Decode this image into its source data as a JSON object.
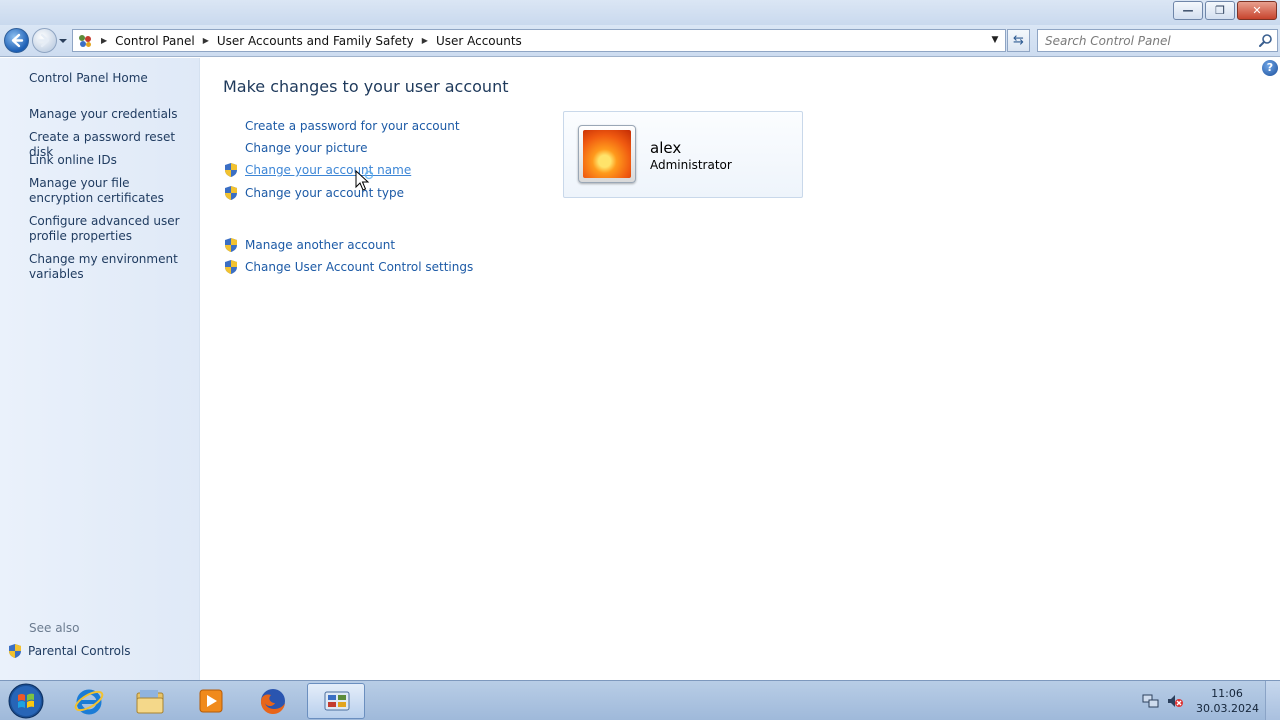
{
  "window": {
    "minimize_glyph": "—",
    "restore_glyph": "❐",
    "close_glyph": "✕"
  },
  "address_bar": {
    "breadcrumbs": [
      "Control Panel",
      "User Accounts and Family Safety",
      "User Accounts"
    ]
  },
  "search": {
    "placeholder": "Search Control Panel"
  },
  "left_pane": {
    "home": "Control Panel Home",
    "links": [
      "Manage your credentials",
      "Create a password reset disk",
      "Link online IDs",
      "Manage your file encryption certificates",
      "Configure advanced user profile properties",
      "Change my environment variables"
    ],
    "see_also_label": "See also",
    "see_also_links": [
      "Parental Controls"
    ]
  },
  "main": {
    "title": "Make changes to your user account",
    "tasks": [
      {
        "label": "Create a password for your account",
        "shield": false
      },
      {
        "label": "Change your picture",
        "shield": false
      },
      {
        "label": "Change your account name",
        "shield": true,
        "hovered": true
      },
      {
        "label": "Change your account type",
        "shield": true
      }
    ],
    "tasks2": [
      {
        "label": "Manage another account",
        "shield": true
      },
      {
        "label": "Change User Account Control settings",
        "shield": true
      }
    ]
  },
  "account": {
    "name": "alex",
    "role": "Administrator"
  },
  "help_glyph": "?",
  "taskbar": {
    "apps": [
      "windows-explorer",
      "internet-explorer",
      "file-explorer",
      "media-player",
      "firefox",
      "control-panel"
    ],
    "active_app": "control-panel",
    "clock_time": "11:06",
    "clock_date": "30.03.2024"
  },
  "colors": {
    "link": "#1c5aa6",
    "link_hover": "#3d86d6",
    "heading": "#1e395b"
  }
}
